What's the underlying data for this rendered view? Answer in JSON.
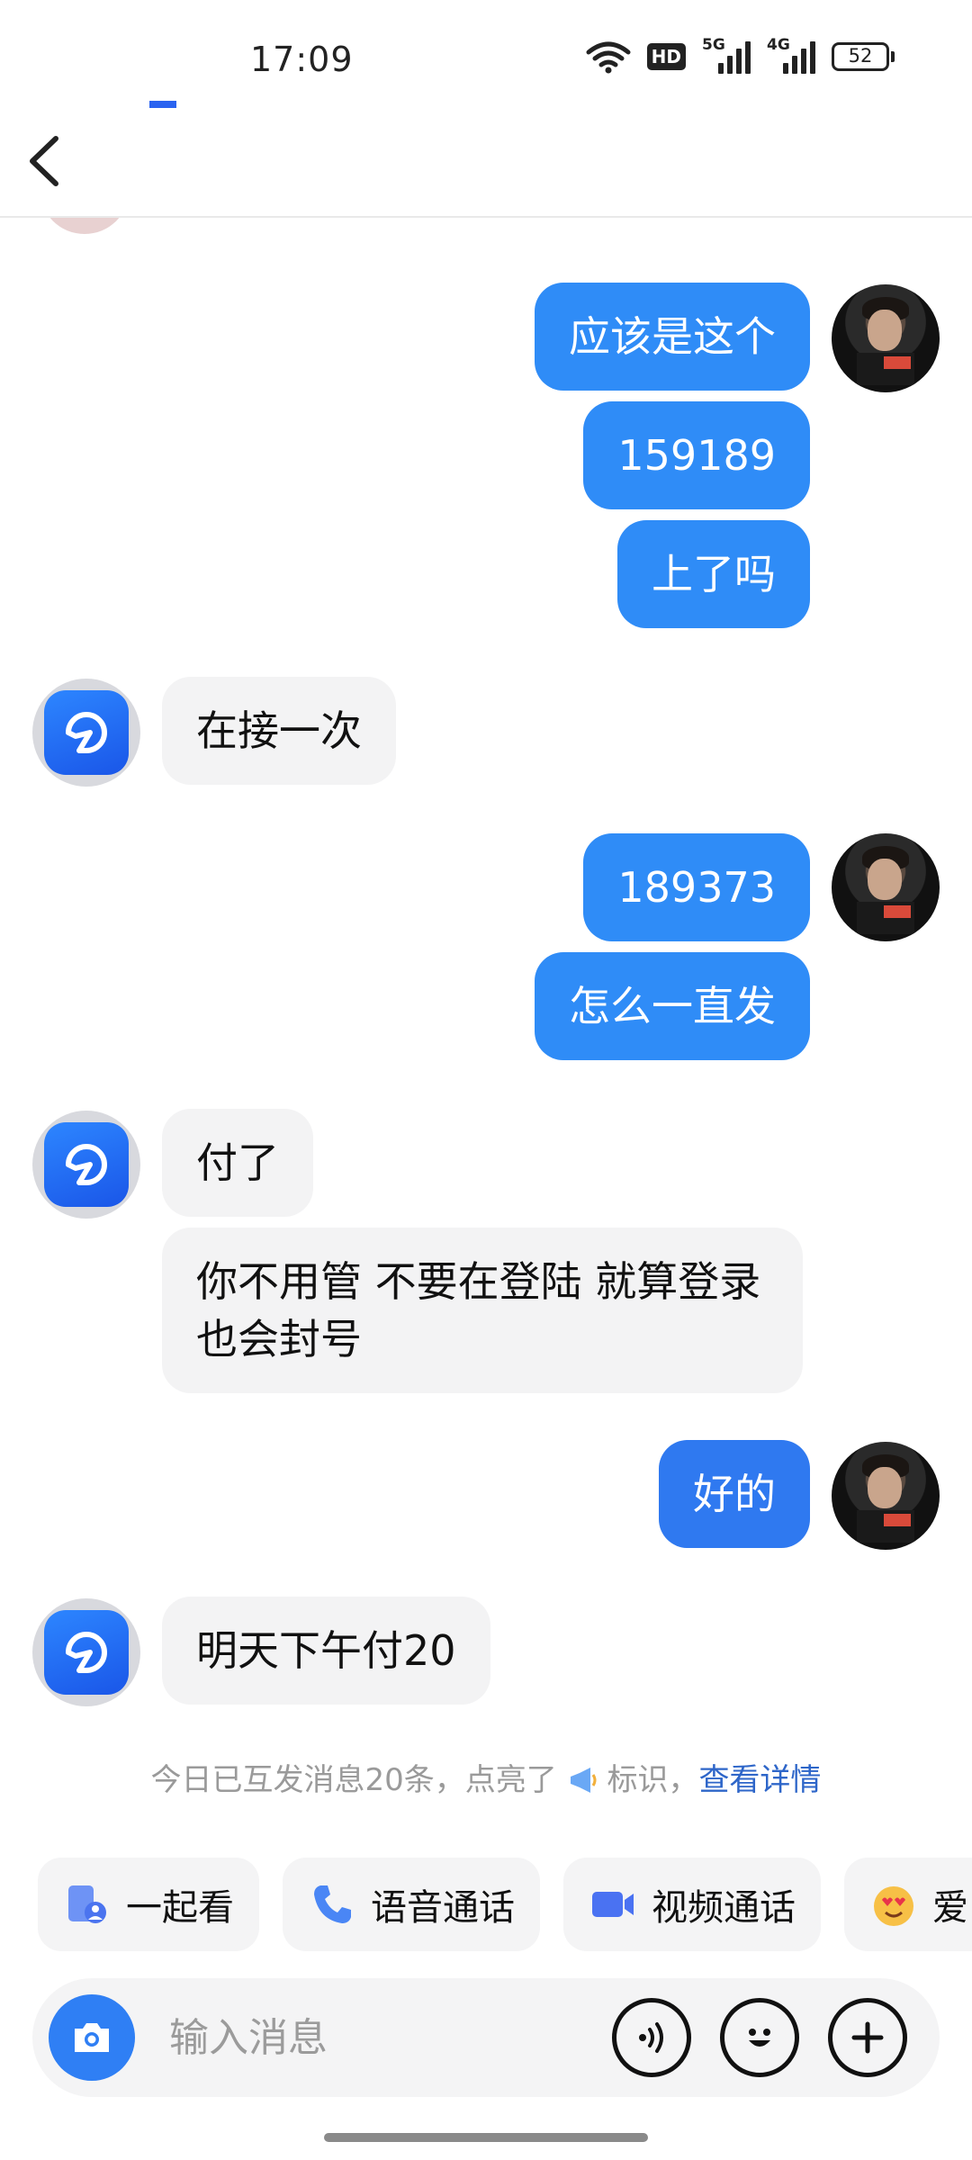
{
  "status_bar": {
    "time": "17:09",
    "hd_label": "HD",
    "net1": "5G",
    "net2": "4G",
    "battery": "52"
  },
  "header": {
    "name_obscured": true
  },
  "messages": [
    {
      "side": "out",
      "text": "应该是这个"
    },
    {
      "side": "out",
      "text": "159189"
    },
    {
      "side": "out",
      "text": "上了吗"
    },
    {
      "side": "in",
      "text": "在接一次"
    },
    {
      "side": "out",
      "text": "189373"
    },
    {
      "side": "out",
      "text": "怎么一直发"
    },
    {
      "side": "in",
      "text": "付了"
    },
    {
      "side": "in",
      "text": "你不用管 不要在登陆 就算登录也会封号"
    },
    {
      "side": "out",
      "text": "好的"
    },
    {
      "side": "in",
      "text": "明天下午付20"
    }
  ],
  "notice": {
    "prefix": "今日已互发消息20条，点亮了",
    "suffix": "标识，",
    "link": "查看详情"
  },
  "quick_actions": [
    {
      "label": "一起看",
      "icon": "watch-together-icon"
    },
    {
      "label": "语音通话",
      "icon": "phone-icon"
    },
    {
      "label": "视频通话",
      "icon": "video-camera-icon"
    },
    {
      "label": "爱",
      "icon": "heart-eyes-emoji-icon"
    }
  ],
  "input": {
    "placeholder": "输入消息"
  },
  "colors": {
    "outgoing_bubble": "#2f8cf7",
    "incoming_bubble": "#f3f3f4",
    "link": "#2e66c9",
    "camera_button": "#2f7ff4"
  }
}
